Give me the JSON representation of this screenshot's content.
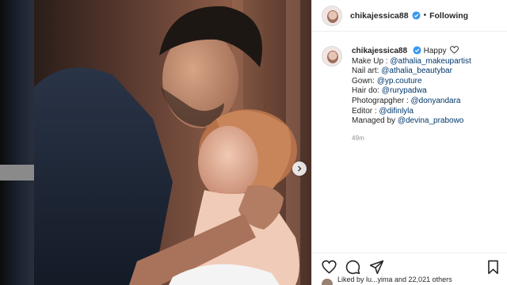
{
  "post": {
    "username": "chikajessica88",
    "follow_status": "Following",
    "separator": "•",
    "caption_lines": [
      {
        "label": "Happy",
        "mention": ""
      },
      {
        "label": "Make Up : ",
        "mention": "@athalia_makeupartist"
      },
      {
        "label": "Nail art: ",
        "mention": "@athalia_beautybar"
      },
      {
        "label": "Gown: ",
        "mention": "@yp.couture"
      },
      {
        "label": "Hair do: ",
        "mention": "@rurypadwa"
      },
      {
        "label": "Photograpgher : ",
        "mention": "@donyandara"
      },
      {
        "label": "Editor : ",
        "mention": "@difinlyla"
      },
      {
        "label": "Managed by ",
        "mention": "@devina_prabowo"
      }
    ],
    "timestamp": "49m",
    "liked_by_text": "Liked by lu...yima and 22,021 others"
  },
  "icons": {
    "like": "heart-icon",
    "comment": "comment-icon",
    "share": "share-icon",
    "save": "bookmark-icon",
    "verified": "verified-badge-icon",
    "next": "chevron-right-icon"
  },
  "colors": {
    "verified_blue": "#3897f0",
    "mention_blue": "#00376b",
    "timestamp_gray": "#8e8e8e"
  }
}
